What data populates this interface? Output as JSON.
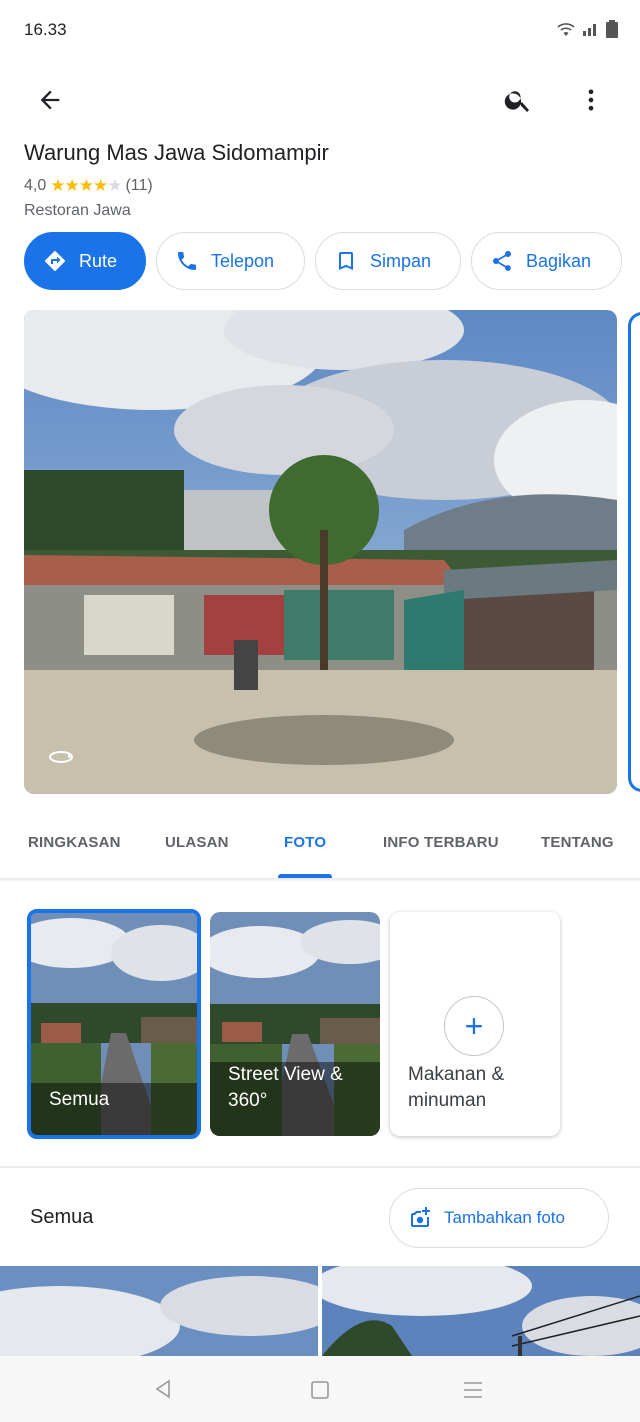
{
  "status_bar": {
    "time": "16.33"
  },
  "place": {
    "name": "Warung Mas Jawa Sidomampir",
    "rating": "4,0",
    "stars_filled": 4,
    "stars_total": 5,
    "review_count": "(11)",
    "category": "Restoran Jawa"
  },
  "actions": [
    {
      "label": "Rute",
      "icon": "directions-icon"
    },
    {
      "label": "Telepon",
      "icon": "phone-icon"
    },
    {
      "label": "Simpan",
      "icon": "bookmark-icon"
    },
    {
      "label": "Bagikan",
      "icon": "share-icon"
    }
  ],
  "tabs": [
    "RINGKASAN",
    "ULASAN",
    "FOTO",
    "INFO TERBARU",
    "TENTANG"
  ],
  "active_tab": "FOTO",
  "photo_categories": [
    {
      "label": "Semua"
    },
    {
      "label": "Street View & 360°"
    },
    {
      "label": "Makanan & minuman"
    }
  ],
  "section": {
    "title": "Semua",
    "add_photo_label": "Tambahkan foto"
  },
  "colors": {
    "accent": "#1a73e8",
    "star": "#fbbc04"
  }
}
